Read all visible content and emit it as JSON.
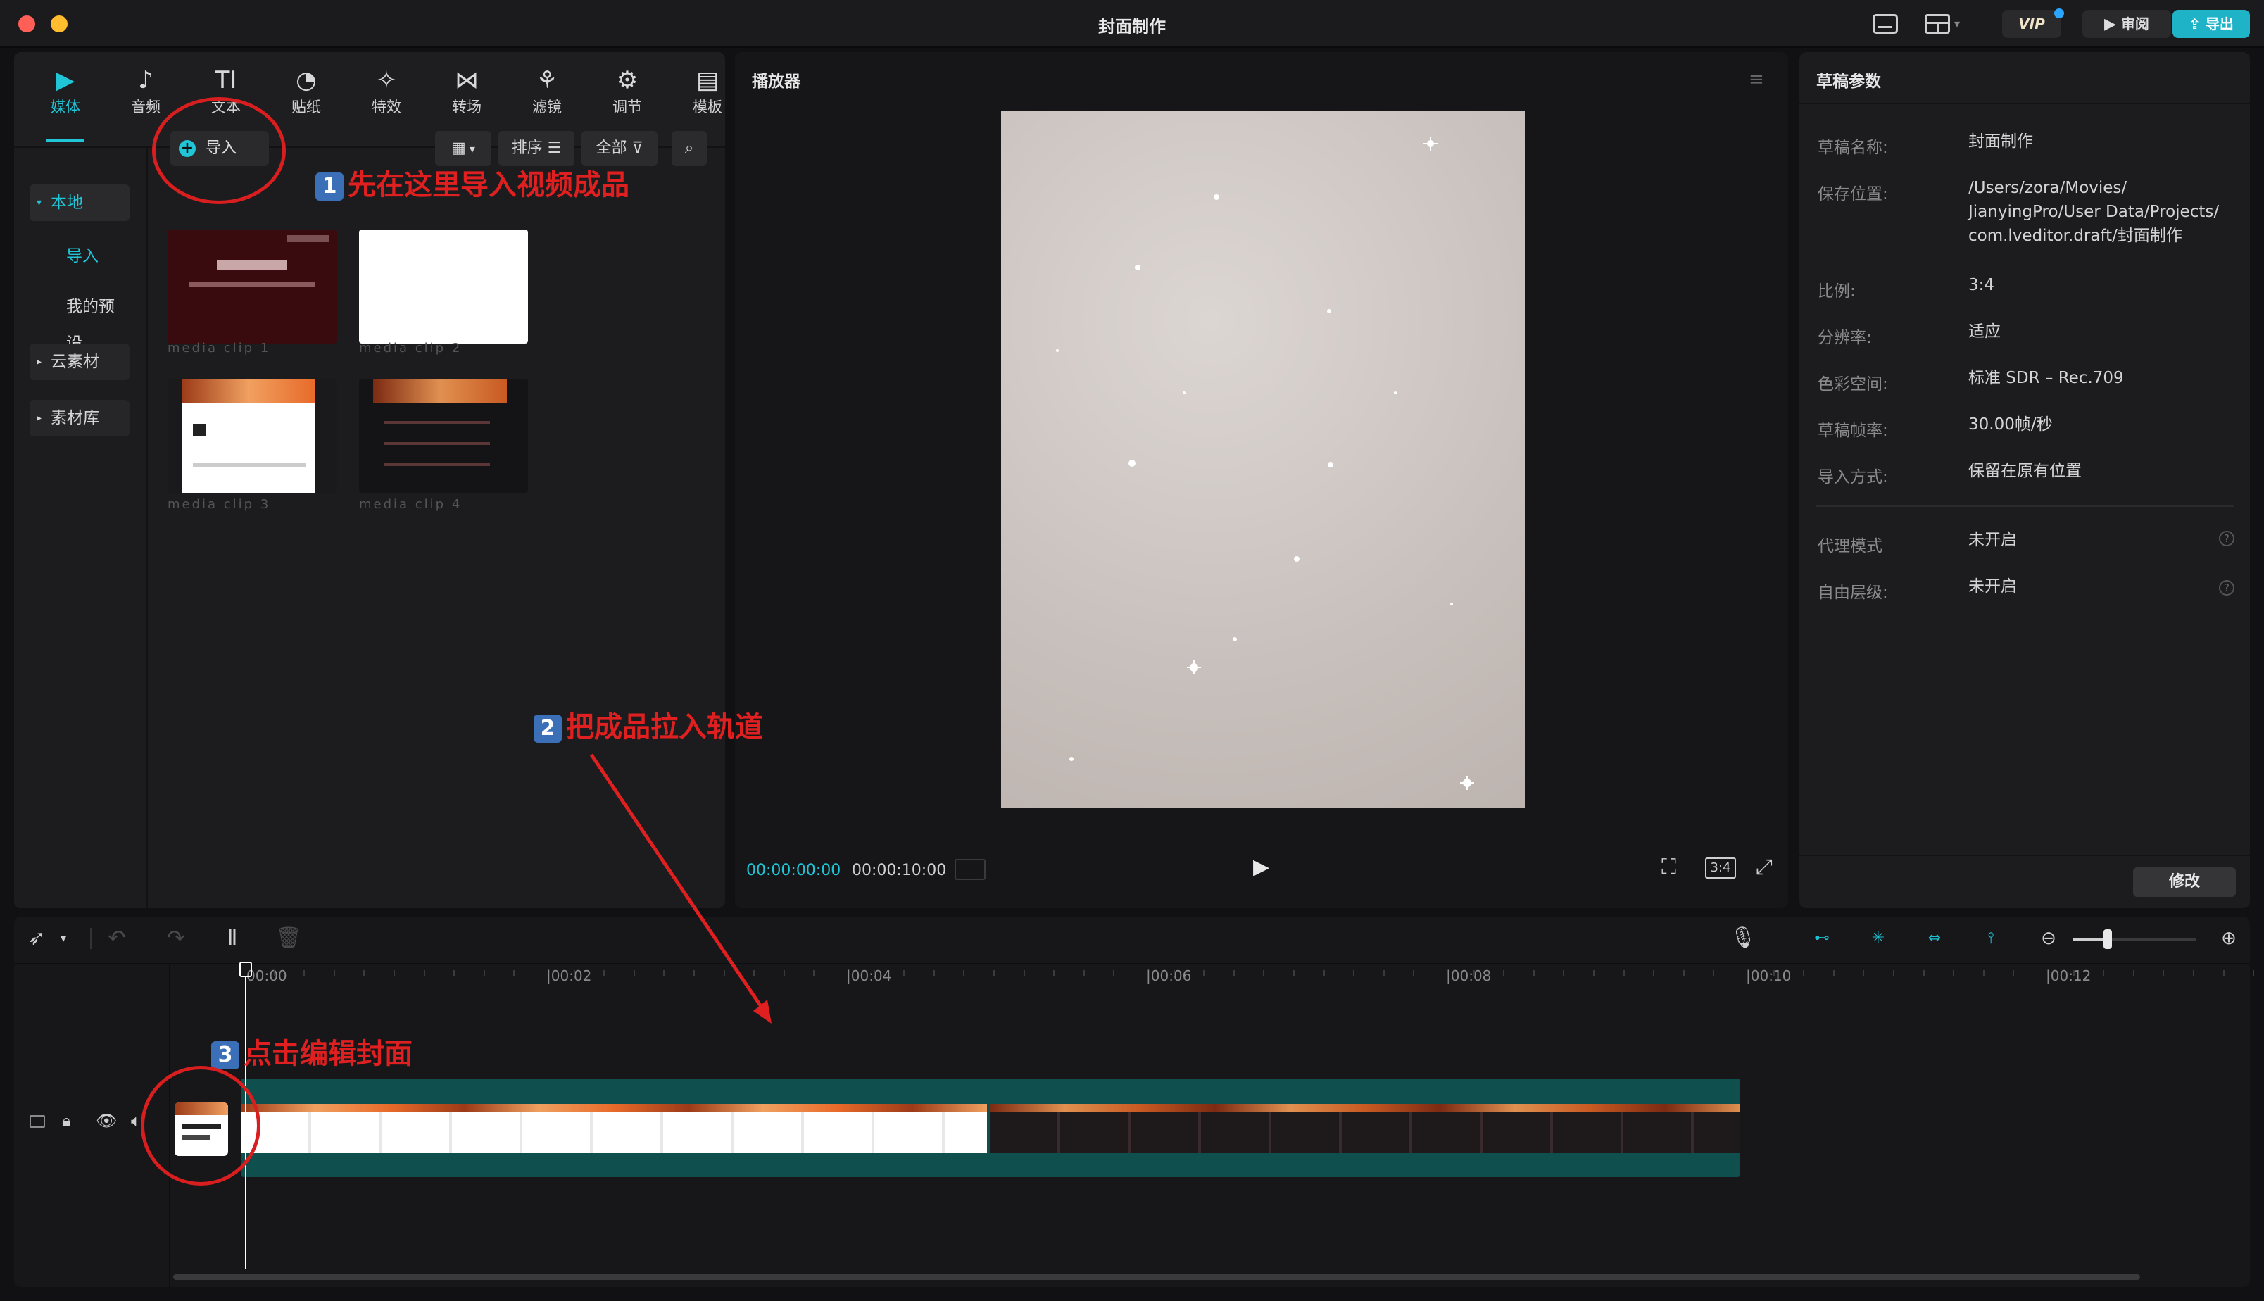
{
  "window": {
    "title": "封面制作"
  },
  "titlebar": {
    "vip": "VIP",
    "review": "审阅",
    "export": "导出"
  },
  "media_toolbar": [
    {
      "label": "媒体",
      "icon": "media-icon",
      "glyph": "▶",
      "active": true
    },
    {
      "label": "音频",
      "icon": "audio-icon",
      "glyph": "♪"
    },
    {
      "label": "文本",
      "icon": "text-icon",
      "glyph": "TI"
    },
    {
      "label": "贴纸",
      "icon": "sticker-icon",
      "glyph": "◔"
    },
    {
      "label": "特效",
      "icon": "effects-icon",
      "glyph": "✧"
    },
    {
      "label": "转场",
      "icon": "transition-icon",
      "glyph": "⋈"
    },
    {
      "label": "滤镜",
      "icon": "filter-icon",
      "glyph": "⚘"
    },
    {
      "label": "调节",
      "icon": "adjust-icon",
      "glyph": "⚙"
    },
    {
      "label": "模板",
      "icon": "template-icon",
      "glyph": "▤"
    }
  ],
  "sidebar": {
    "local": "本地",
    "import": "导入",
    "my_presets": "我的预设",
    "cloud": "云素材",
    "library": "素材库"
  },
  "media": {
    "import_button": "导入",
    "sort": "排序",
    "all": "全部",
    "section_label": "",
    "items": [
      {
        "caption": "media clip 1"
      },
      {
        "caption": "media clip 2"
      },
      {
        "caption": "media clip 3"
      },
      {
        "caption": "media clip 4"
      }
    ]
  },
  "annotations": {
    "step1_num": "1",
    "step1": "先在这里导入视频成品",
    "step2_num": "2",
    "step2": "把成品拉入轨道",
    "step3_num": "3",
    "step3": "点击编辑封面"
  },
  "player": {
    "title": "播放器",
    "current_time": "00:00:00:00",
    "total_time": "00:00:10:00",
    "aspect": "3:4"
  },
  "props": {
    "title": "草稿参数",
    "rows": [
      {
        "label": "草稿名称:",
        "value": "封面制作"
      },
      {
        "label": "保存位置:",
        "value": "/Users/zora/Movies/\nJianyingPro/User Data/Projects/\ncom.lveditor.draft/封面制作"
      },
      {
        "label": "比例:",
        "value": "3:4"
      },
      {
        "label": "分辨率:",
        "value": "适应"
      },
      {
        "label": "色彩空间:",
        "value": "标准 SDR – Rec.709"
      },
      {
        "label": "草稿帧率:",
        "value": "30.00帧/秒"
      },
      {
        "label": "导入方式:",
        "value": "保留在原有位置"
      }
    ],
    "rows2": [
      {
        "label": "代理模式",
        "value": "未开启"
      },
      {
        "label": "自由层级:",
        "value": "未开启"
      }
    ],
    "modify_button": "修改"
  },
  "timeline": {
    "ticks": [
      "00:00",
      "|00:02",
      "|00:04",
      "|00:06",
      "|00:08",
      "|00:10",
      "|00:12"
    ],
    "clip1_label": "",
    "clip2_label": ""
  },
  "colors": {
    "accent": "#20c6d8",
    "annotation": "#e02020",
    "clip_track": "#0f4f4d"
  }
}
